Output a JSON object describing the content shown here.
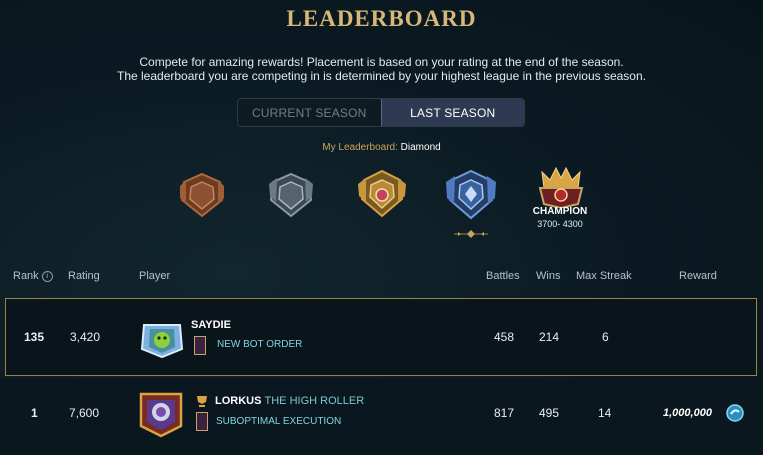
{
  "page": {
    "title": "LEADERBOARD",
    "description_line1": "Compete for amazing rewards! Placement is based on your rating at the end of the season.",
    "description_line2": "The leaderboard you are competing in is determined by your highest league in the previous season."
  },
  "season_toggle": {
    "current_label": "CURRENT SEASON",
    "last_label": "LAST SEASON",
    "selected": "LAST SEASON"
  },
  "my_leaderboard": {
    "label": "My Leaderboard:",
    "value": "Diamond"
  },
  "leagues": [
    {
      "name": "bronze",
      "color": "#b06a3c"
    },
    {
      "name": "silver",
      "color": "#8a9aa6"
    },
    {
      "name": "gold",
      "color": "#d9a441"
    },
    {
      "name": "diamond",
      "color": "#6f9bd6",
      "selected": true
    },
    {
      "name": "champion",
      "color": "#c9a45c",
      "label": "CHAMPION",
      "range": "3700- 4300"
    }
  ],
  "table": {
    "headers": {
      "rank": "Rank",
      "rating": "Rating",
      "player": "Player",
      "battles": "Battles",
      "wins": "Wins",
      "max_streak": "Max Streak",
      "reward": "Reward"
    },
    "my_row": {
      "rank": "135",
      "rating": "3,420",
      "name": "SAYDIE",
      "title": "",
      "guild": "NEW BOT ORDER",
      "battles": "458",
      "wins": "214",
      "max_streak": "6",
      "reward": ""
    },
    "rows": [
      {
        "rank": "1",
        "rating": "7,600",
        "name": "LORKUS",
        "title": "THE HIGH ROLLER",
        "guild": "SUBOPTIMAL EXECUTION",
        "battles": "817",
        "wins": "495",
        "max_streak": "14",
        "reward": "1,000,000"
      }
    ]
  },
  "colors": {
    "accent_gold": "#c9a45c",
    "guild_cyan": "#7fd6e0",
    "toggle_active": "#2d3a52"
  }
}
